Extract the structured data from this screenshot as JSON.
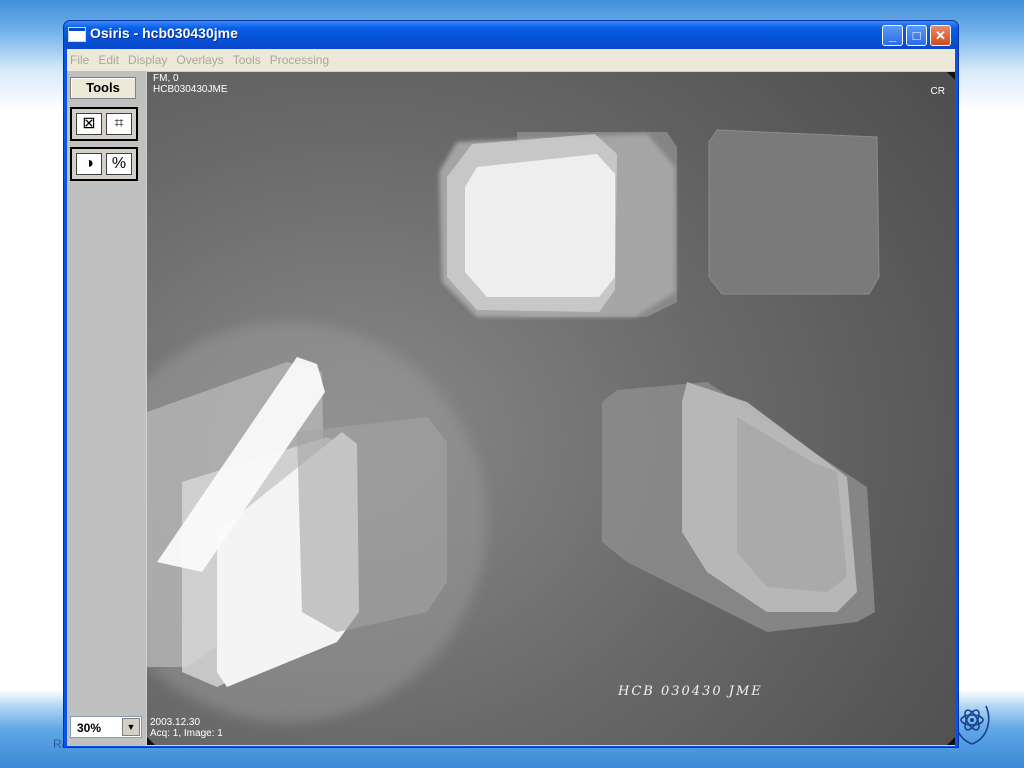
{
  "window": {
    "title": "Osiris - hcb030430jme",
    "minimize_glyph": "_",
    "maximize_glyph": "□",
    "close_glyph": "✕"
  },
  "menu": [
    "File",
    "Edit",
    "Display",
    "Overlays",
    "Tools",
    "Processing"
  ],
  "toolbar": {
    "tools_label": "Tools",
    "icons": [
      "fit-to-window-icon",
      "shrink-icon",
      "contrast-icon",
      "percent-icon"
    ],
    "zoom_value": "30%"
  },
  "viewer": {
    "overlay_top_left_1": "FM, 0",
    "overlay_top_left_2": "HCB030430JME",
    "overlay_top_right": "CR",
    "overlay_bottom_left_1": "2003.12.30",
    "overlay_bottom_left_2": "Acq: 1, Image: 1",
    "handwritten_label": "HCB 030430 JME"
  },
  "slide": {
    "footer_text": "Ra"
  }
}
